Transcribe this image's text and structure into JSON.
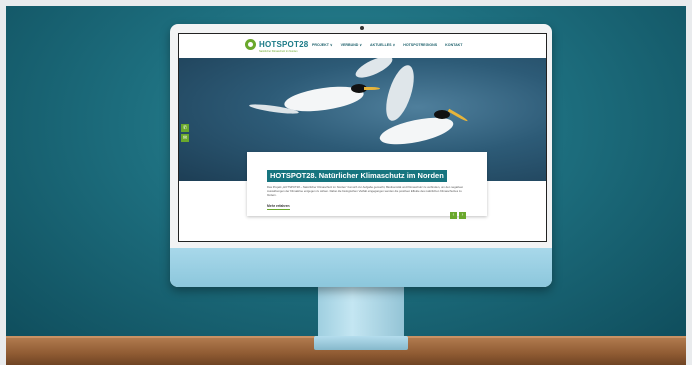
{
  "site": {
    "logo_text": "HOTSPOT28",
    "logo_subtitle": "Natürlicher Klimaschutz im Norden",
    "nav": [
      {
        "label": "PROJEKT ∨"
      },
      {
        "label": "VERBUND ∨"
      },
      {
        "label": "AKTUELLES ∨"
      },
      {
        "label": "HOTSPOTREGIONS"
      },
      {
        "label": "KONTAKT"
      }
    ],
    "side_buttons": [
      {
        "icon": "phone-icon",
        "glyph": "✆"
      },
      {
        "icon": "mail-icon",
        "glyph": "✉"
      }
    ],
    "card": {
      "title": "HOTSPOT28. Natürlicher Klimaschutz im Norden",
      "text": "Das Projekt „HOTSPOT28 – Natürlicher Klimaschutz im Norden“ hat sich zur Aufgabe gemacht, Biodiversität und Klimaschutz zu verbinden, um den negativen Auswirkungen der Klimakrise entgegen zu wirken. Dabei die biologischen Vielfalt eingegangen werden die positiven Effekte des natürlichen Klimaschutzes zu fördern.",
      "link": "Mehr erfahren",
      "prev": "‹",
      "next": "›"
    }
  },
  "colors": {
    "accent": "#6aa82c",
    "brand": "#17757f"
  }
}
